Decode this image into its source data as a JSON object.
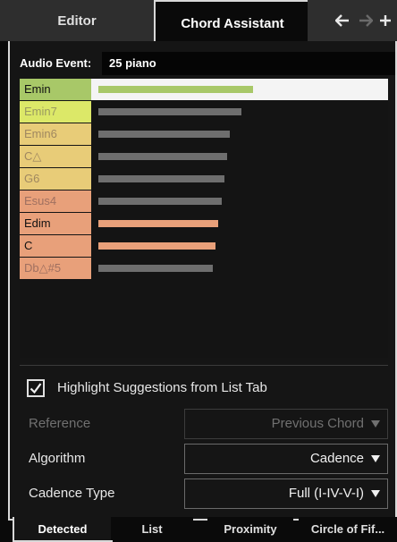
{
  "top_tabs": [
    {
      "label": "Editor",
      "active": false
    },
    {
      "label": "Chord Assistant",
      "active": true
    }
  ],
  "nav_icons": [
    "arrow-left-icon",
    "arrow-right-icon",
    "plus-icon"
  ],
  "audio_event": {
    "label": "Audio Event:",
    "value": "25 piano"
  },
  "chords": [
    {
      "name": "Emin",
      "chip_color": "#a8c868",
      "text_color": "#111111",
      "bar_color": "#a8c868",
      "bar_fraction": 0.54,
      "selected": true
    },
    {
      "name": "Emin7",
      "chip_color": "#dce868",
      "text_color": "#9a9a60",
      "bar_color": "#6e6e6e",
      "bar_fraction": 0.5
    },
    {
      "name": "Emin6",
      "chip_color": "#e8cc78",
      "text_color": "#a08860",
      "bar_color": "#6e6e6e",
      "bar_fraction": 0.46
    },
    {
      "name": "C△",
      "chip_color": "#e8cc78",
      "text_color": "#a08860",
      "bar_color": "#6e6e6e",
      "bar_fraction": 0.45
    },
    {
      "name": "G6",
      "chip_color": "#e8cc78",
      "text_color": "#a08860",
      "bar_color": "#6e6e6e",
      "bar_fraction": 0.44
    },
    {
      "name": "Esus4",
      "chip_color": "#e8a07a",
      "text_color": "#a07060",
      "bar_color": "#6e6e6e",
      "bar_fraction": 0.43
    },
    {
      "name": "Edim",
      "chip_color": "#e8a07a",
      "text_color": "#111111",
      "bar_color": "#e8a07a",
      "bar_fraction": 0.42
    },
    {
      "name": "C",
      "chip_color": "#e8a07a",
      "text_color": "#111111",
      "bar_color": "#e8a07a",
      "bar_fraction": 0.41
    },
    {
      "name": "Db△#5",
      "chip_color": "#e8a07a",
      "text_color": "#a07060",
      "bar_color": "#6e6e6e",
      "bar_fraction": 0.4
    }
  ],
  "highlight": {
    "label": "Highlight Suggestions from List Tab",
    "checked": true
  },
  "reference": {
    "label": "Reference",
    "value": "Previous Chord",
    "enabled": false
  },
  "algorithm": {
    "label": "Algorithm",
    "value": "Cadence"
  },
  "cadence_type": {
    "label": "Cadence Type",
    "value": "Full (I-IV-V-I)"
  },
  "bottom_tabs": [
    {
      "label": "Detected",
      "active": true
    },
    {
      "label": "List",
      "active": false
    },
    {
      "label": "Proximity",
      "active": false
    },
    {
      "label": "Circle of Fif...",
      "active": false
    }
  ],
  "colors": {
    "accent_selected": "#f4f4f4",
    "panel_bg": "#151515",
    "frame": "#d8d8d8"
  }
}
